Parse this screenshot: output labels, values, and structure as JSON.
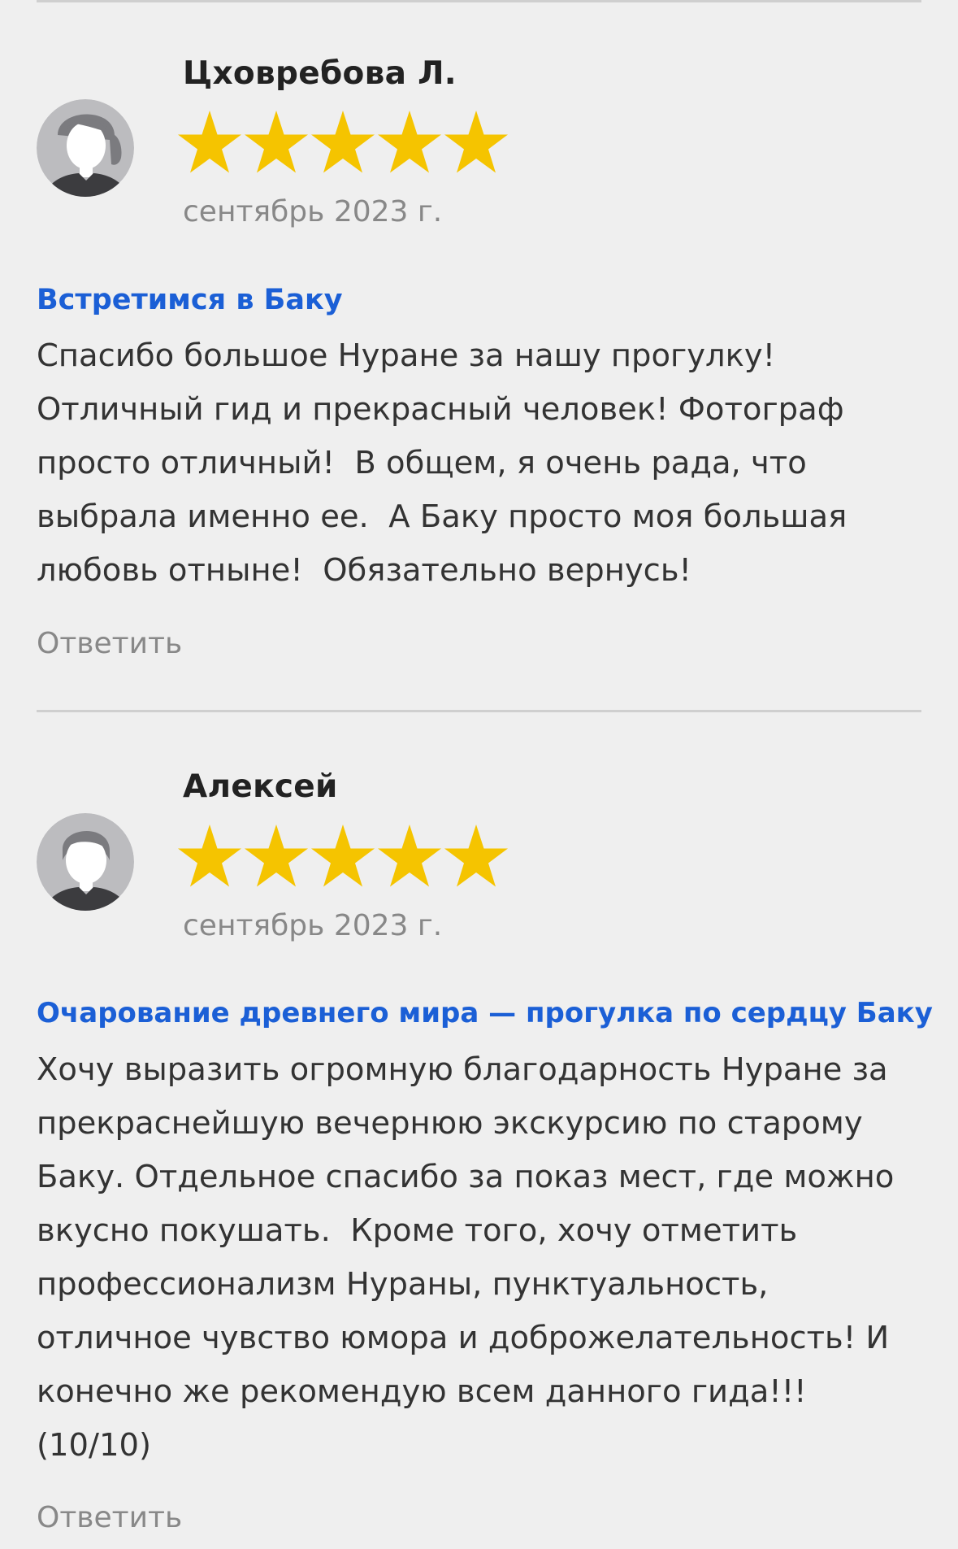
{
  "reviews": [
    {
      "author": "Цховребова Л.",
      "rating": 5,
      "max_rating": 5,
      "date": "сентябрь 2023 г.",
      "tour_title": "Встретимся в Баку",
      "text": "Спасибо большое Нуране за нашу прогулку!\nОтличный гид и прекрасный человек! Фотограф\nпросто отличный!  В общем, я очень рада, что\nвыбрала именно ее.  А Баку просто моя большая\nлюбовь отныне!  Обязательно вернусь!",
      "reply_label": "Ответить",
      "avatar_icon": "female-user-icon"
    },
    {
      "author": "Алексей",
      "rating": 5,
      "max_rating": 5,
      "date": "сентябрь 2023 г.",
      "tour_title": "Очарование древнего мира — прогулка по сердцу Баку",
      "text": "Хочу выразить огромную благодарность Нуране за\nпрекраснейшую вечернюю экскурсию по старому\nБаку. Отдельное спасибо за показ мест, где можно\nвкусно покушать.  Кроме того, хочу отметить\nпрофессионализм Нураны, пунктуальность,\nотличное чувство юмора и доброжелательность! И\nконечно же рекомендую всем данного гида!!!\n(10/10)",
      "reply_label": "Ответить",
      "avatar_icon": "male-user-icon"
    }
  ],
  "colors": {
    "background": "#efefef",
    "star": "#f5c400",
    "link": "#1b5fd6",
    "muted": "#888888",
    "text": "#333333"
  }
}
